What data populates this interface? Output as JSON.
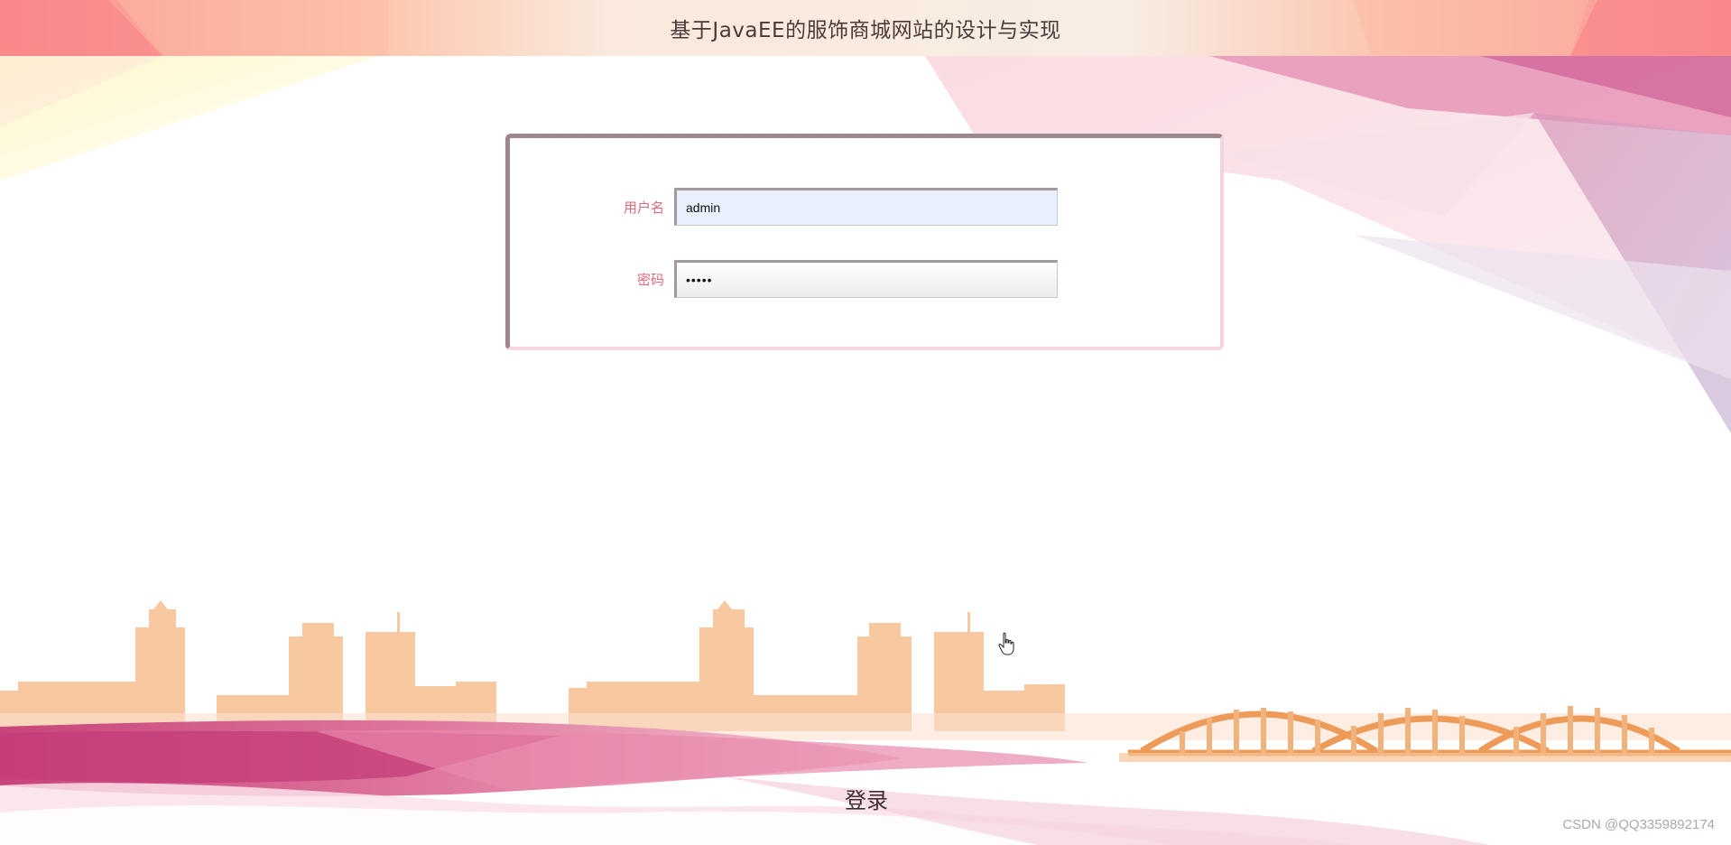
{
  "header": {
    "title": "基于JavaEE的服饰商城网站的设计与实现"
  },
  "login_form": {
    "username_label": "用户名",
    "username_value": "admin",
    "password_label": "密码",
    "password_value": "admin"
  },
  "login_button": {
    "label": "登录"
  },
  "watermark": "CSDN @QQ3359892174",
  "colors": {
    "label": "#e0697b",
    "title": "#4a3b3b",
    "input_fill": "#e8f0fd",
    "skyline": "#f8c9a0",
    "bridge": "#ee9a58",
    "wave": "#c9487c"
  },
  "icons": [
    "hand-pointer-cursor-icon"
  ]
}
